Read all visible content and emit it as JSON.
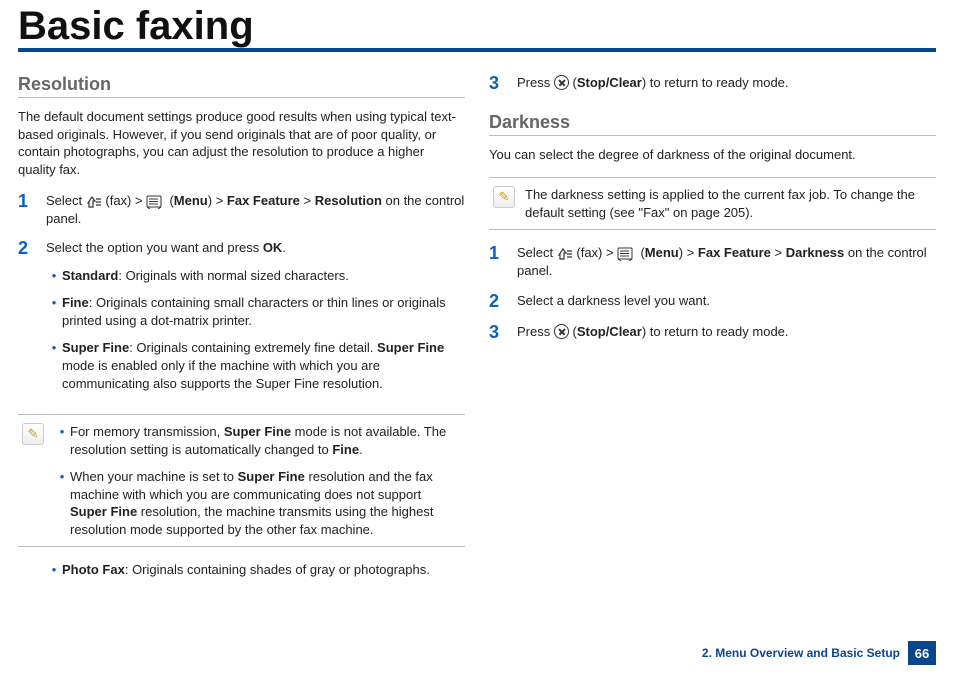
{
  "page_title": "Basic faxing",
  "left": {
    "heading": "Resolution",
    "intro": "The default document settings produce good results when using typical text-based originals. However, if you send originals that are of poor quality, or contain photographs, you can adjust the resolution to produce a higher quality fax.",
    "step1_pre": "Select ",
    "step1_fax": "(fax) > ",
    "step1_menu_paren": "(",
    "step1_menu": "Menu",
    "step1_after_menu": ") > ",
    "step1_faxfeature": "Fax Feature",
    "step1_gt": " > ",
    "step1_resolution": "Resolution",
    "step1_tail": " on the control panel.",
    "step2_pre": "Select the option you want and press ",
    "step2_ok": "OK",
    "step2_tail": ".",
    "opt_standard_b": "Standard",
    "opt_standard": ": Originals with normal sized characters.",
    "opt_fine_b": "Fine",
    "opt_fine": ": Originals containing small characters or thin lines or originals printed using a dot-matrix printer.",
    "opt_superfine_b": "Super Fine",
    "opt_superfine_a": ": Originals containing extremely fine detail. ",
    "opt_superfine_b2": "Super Fine",
    "opt_superfine_c": " mode is enabled only if the machine with which you are communicating also supports the Super Fine resolution.",
    "note1_a": "For memory transmission, ",
    "note1_b": "Super Fine",
    "note1_c": " mode is not available. The resolution setting is automatically changed to ",
    "note1_d": "Fine",
    "note1_e": ".",
    "note2_a": "When your machine is set to ",
    "note2_b": "Super Fine",
    "note2_c": " resolution and the fax machine with which you are communicating does not support ",
    "note2_d": "Super Fine",
    "note2_e": " resolution, the machine transmits using the highest resolution mode supported by the other fax machine.",
    "opt_photo_b": "Photo Fax",
    "opt_photo": ": Originals containing shades of gray or photographs."
  },
  "right": {
    "step3a_pre": "Press ",
    "step3a_paren": "(",
    "step3a_stop": "Stop/Clear",
    "step3a_tail": ") to return to ready mode.",
    "heading": "Darkness",
    "intro": "You can select the degree of darkness of the original document.",
    "note": "The darkness setting is applied to the current fax job. To change the default setting (see \"Fax\" on page 205).",
    "step1_pre": "Select ",
    "step1_fax": "(fax) > ",
    "step1_menu_paren": "(",
    "step1_menu": "Menu",
    "step1_after_menu": ") > ",
    "step1_faxfeature": "Fax Feature",
    "step1_gt": " > ",
    "step1_darkness": "Darkness",
    "step1_tail": " on the control panel.",
    "step2": "Select a darkness level you want.",
    "step3_pre": "Press ",
    "step3_paren": "(",
    "step3_stop": "Stop/Clear",
    "step3_tail": ") to return to ready mode."
  },
  "footer": {
    "chapter": "2. Menu Overview and Basic Setup",
    "page": "66"
  },
  "nums": {
    "n1": "1",
    "n2": "2",
    "n3": "3"
  }
}
